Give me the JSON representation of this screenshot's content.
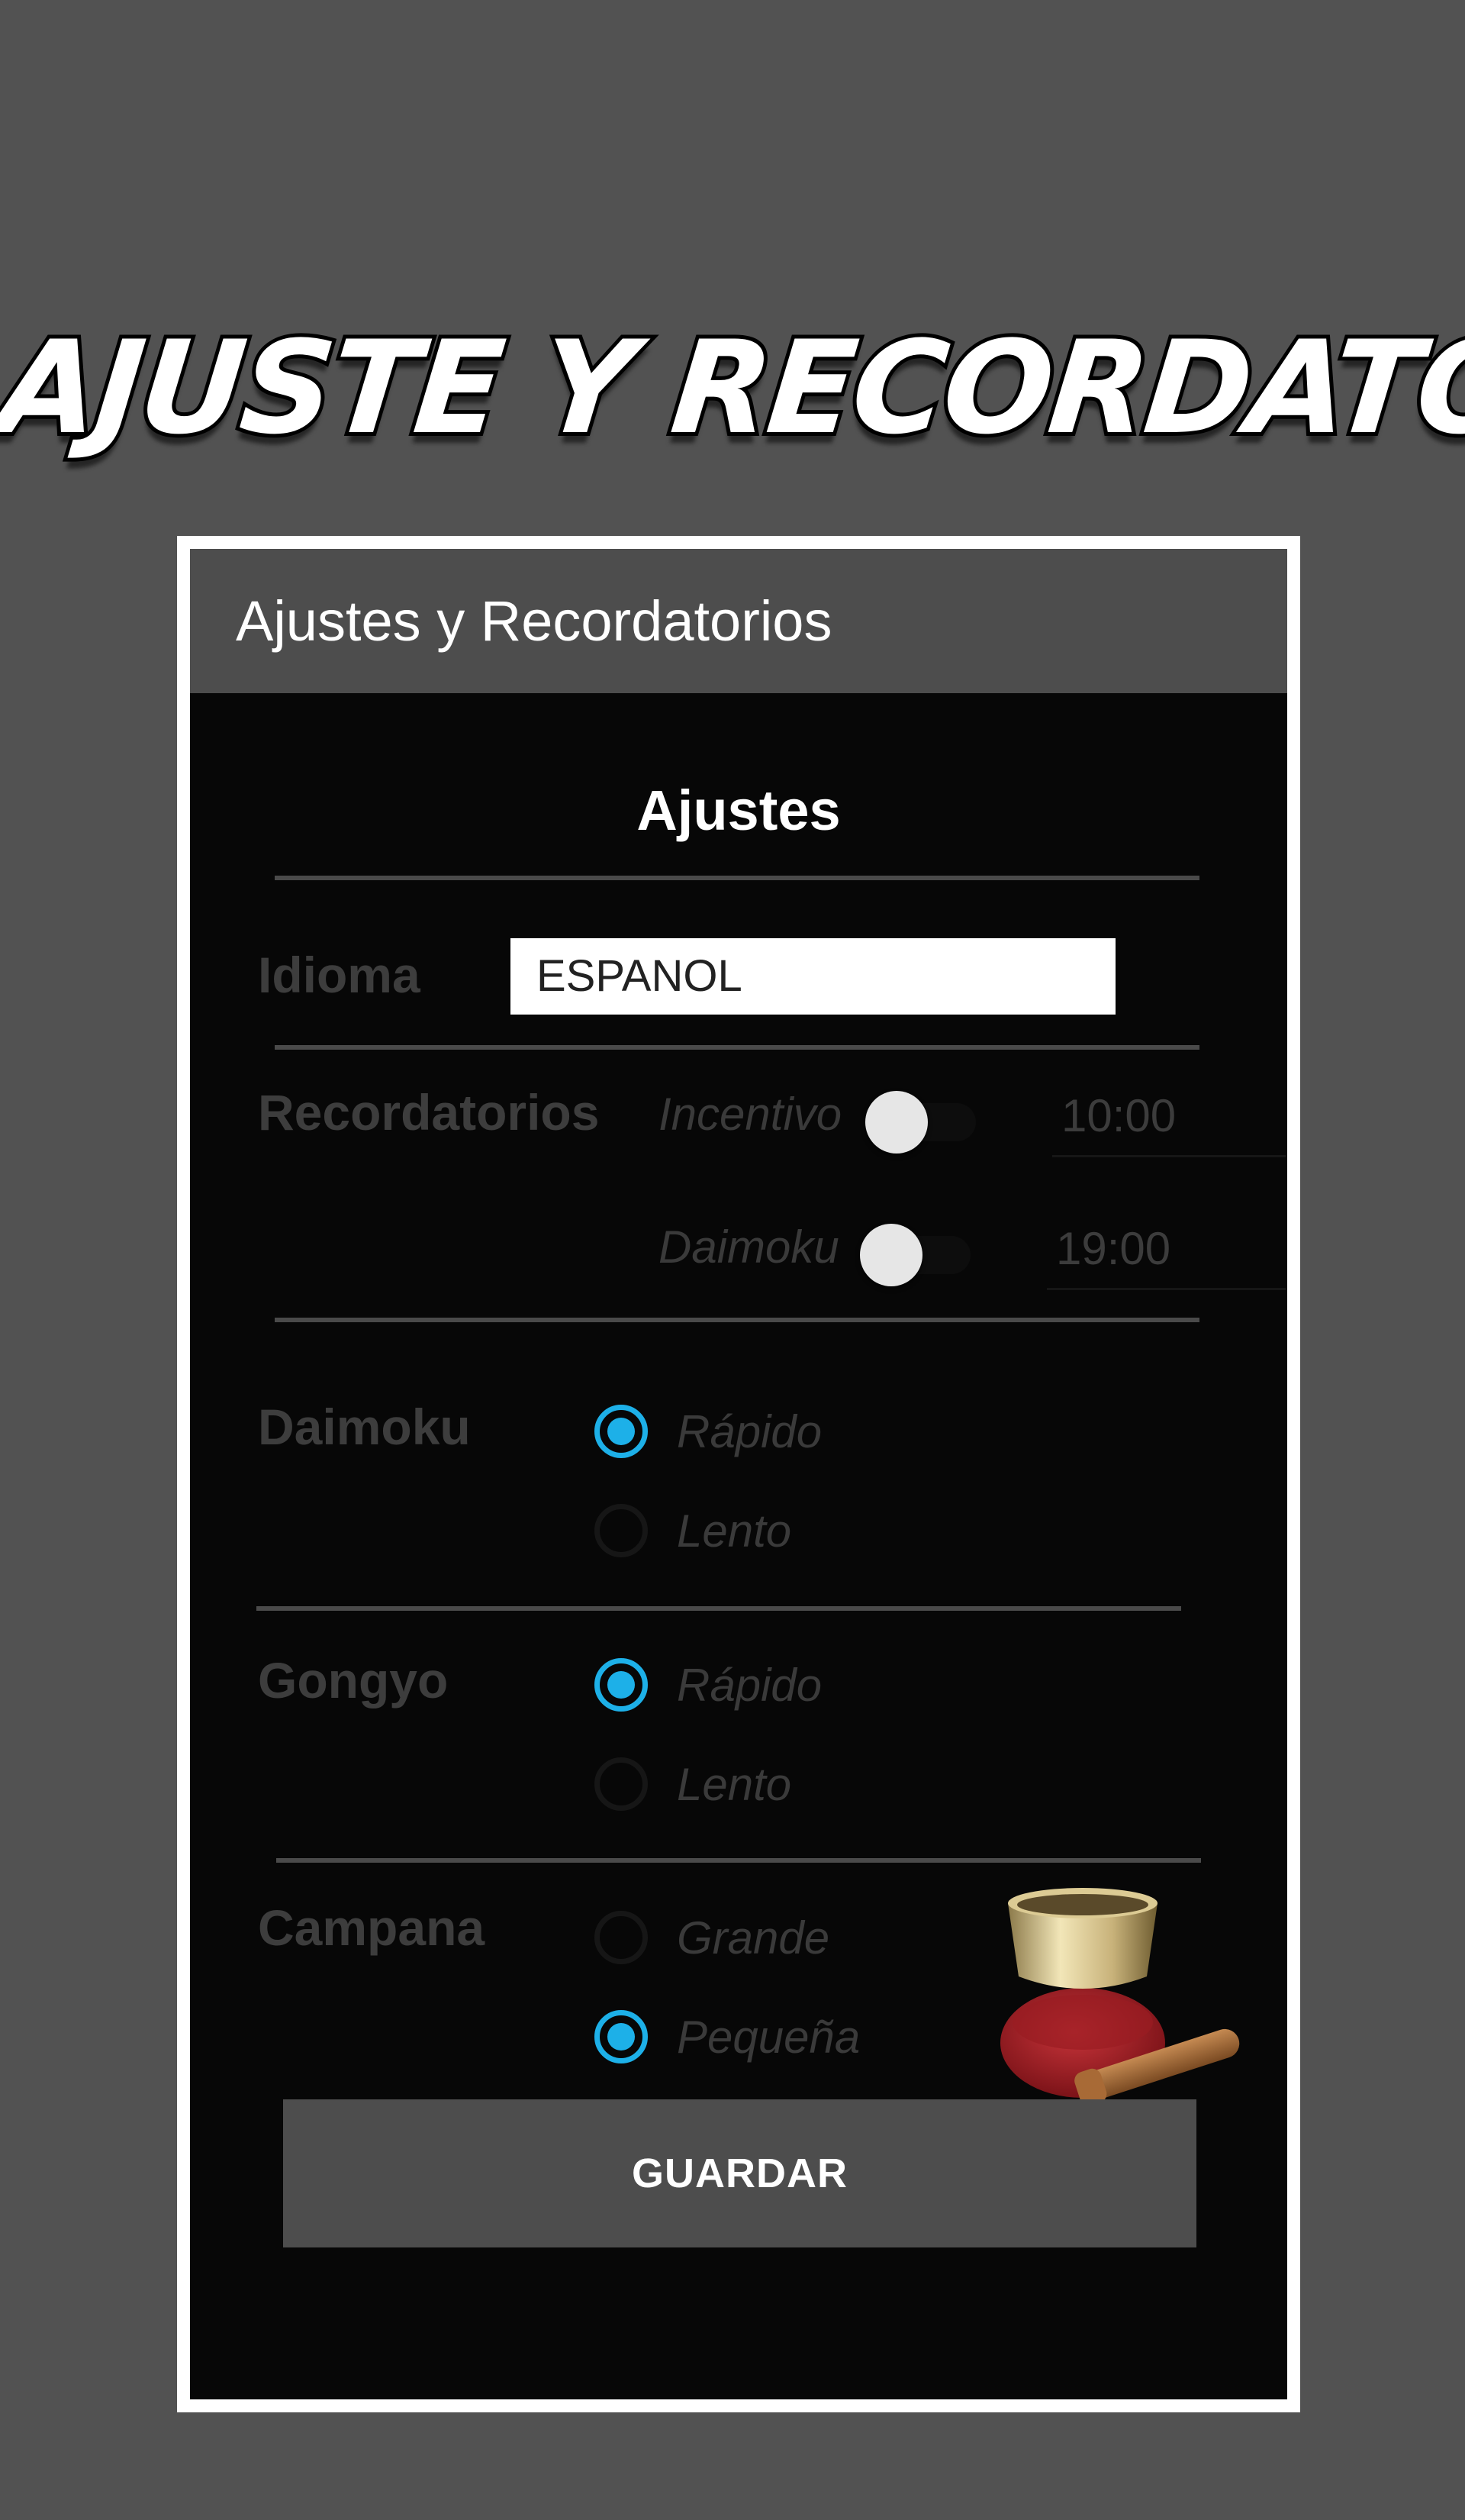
{
  "promo": {
    "title": "AJUSTE Y RECORDATORIOS"
  },
  "app_bar": {
    "title": "Ajustes y Recordatorios"
  },
  "settings": {
    "section_title": "Ajustes",
    "language": {
      "label": "Idioma",
      "value": "ESPANOL"
    },
    "reminders": {
      "label": "Recordatorios",
      "items": [
        {
          "name": "Incentivo",
          "time": "10:00",
          "enabled": false
        },
        {
          "name": "Daimoku",
          "time": "19:00",
          "enabled": false
        }
      ]
    },
    "daimoku": {
      "label": "Daimoku",
      "options": [
        "Rápido",
        "Lento"
      ],
      "selected": "Rápido"
    },
    "gongyo": {
      "label": "Gongyo",
      "options": [
        "Rápido",
        "Lento"
      ],
      "selected": "Rápido"
    },
    "bell": {
      "label": "Campana",
      "options": [
        "Grande",
        "Pequeña"
      ],
      "selected": "Pequeña",
      "icon": "singing-bowl-icon"
    },
    "save_label": "GUARDAR"
  },
  "colors": {
    "accent": "#1db0e8",
    "background": "#525252",
    "panel": "#070707",
    "app_bar": "#4d4d4d"
  }
}
